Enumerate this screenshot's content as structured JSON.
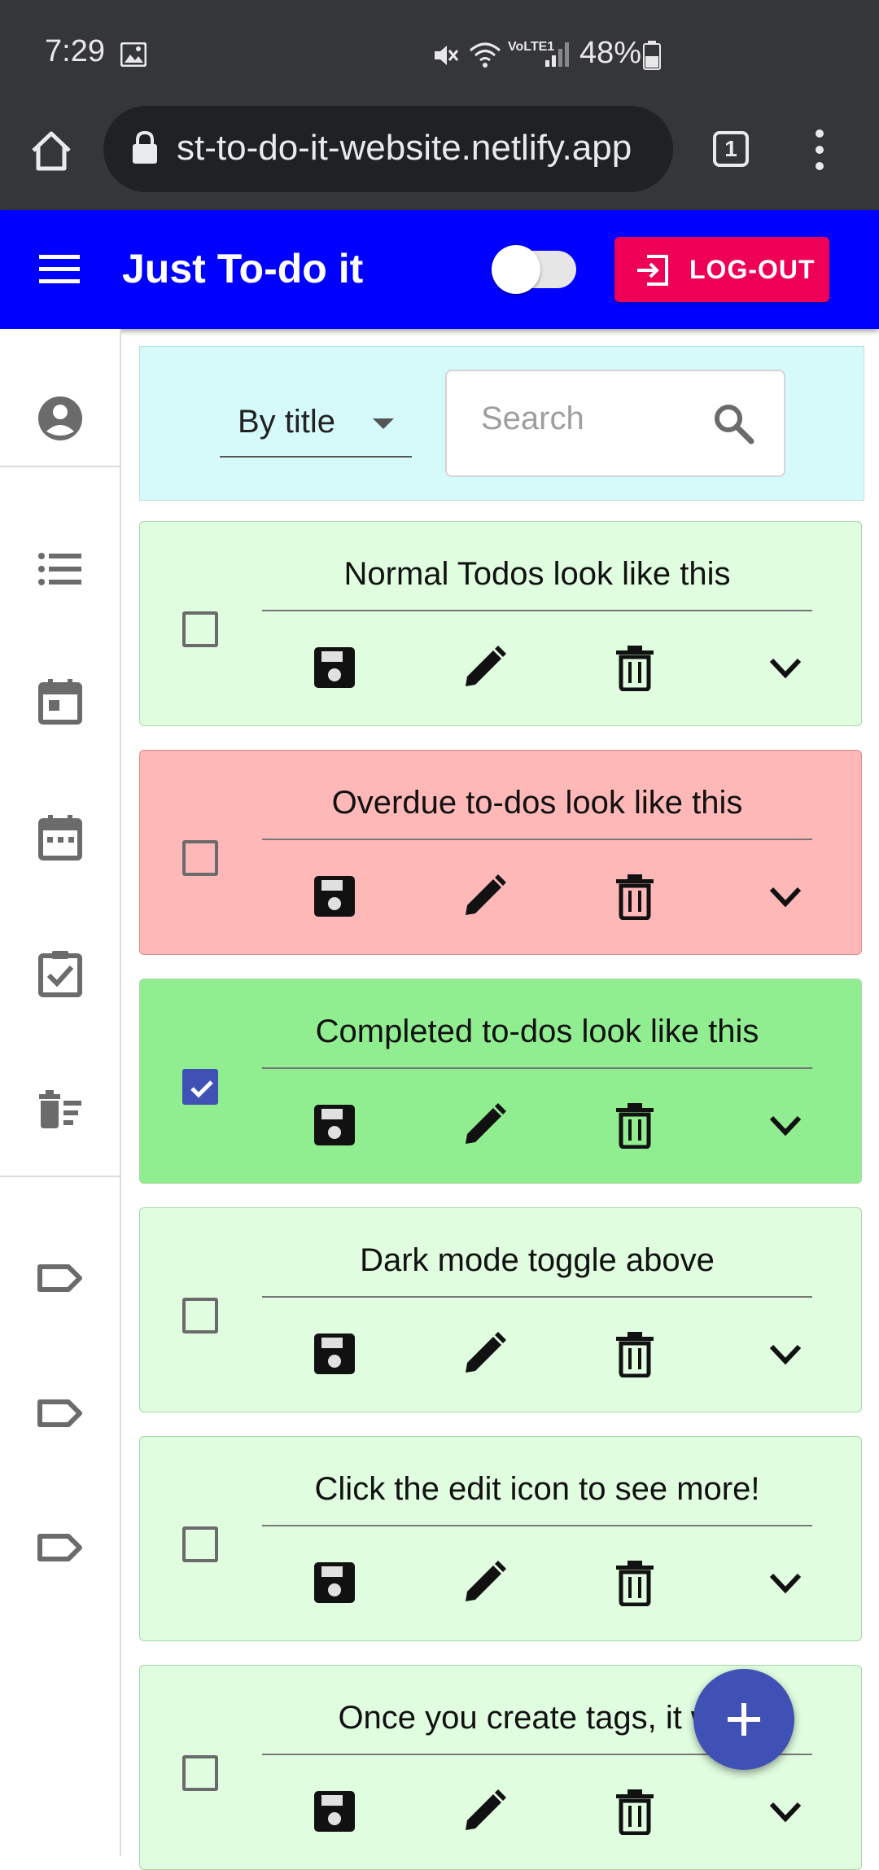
{
  "status_bar": {
    "time": "7:29",
    "battery": "48%",
    "network": "VoLTE1"
  },
  "browser": {
    "url": "st-to-do-it-website.netlify.app",
    "tab_count": "1"
  },
  "app_bar": {
    "title": "Just To-do it",
    "dark_mode_on": false,
    "logout_label": "LOG-OUT"
  },
  "sidebar": {
    "items": [
      {
        "icon": "account-circle-icon"
      },
      {
        "icon": "list-icon"
      },
      {
        "icon": "calendar-today-icon"
      },
      {
        "icon": "calendar-week-icon"
      },
      {
        "icon": "assignment-done-icon"
      },
      {
        "icon": "delete-sweep-icon"
      },
      {
        "icon": "label-icon"
      },
      {
        "icon": "label-icon"
      },
      {
        "icon": "label-icon"
      }
    ]
  },
  "filter": {
    "sort_selected": "By title",
    "search_placeholder": "Search",
    "search_value": ""
  },
  "todos": [
    {
      "title": "Normal Todos look like this",
      "checked": false,
      "status": "normal",
      "bg": "#e0fde0"
    },
    {
      "title": "Overdue to-dos look like this",
      "checked": false,
      "status": "overdue",
      "bg": "#ffb8b8"
    },
    {
      "title": "Completed to-dos look like this",
      "checked": true,
      "status": "completed",
      "bg": "#90ee90"
    },
    {
      "title": "Dark mode toggle above",
      "checked": false,
      "status": "normal",
      "bg": "#e0fde0"
    },
    {
      "title": "Click the edit icon to see more!",
      "checked": false,
      "status": "normal",
      "bg": "#e0fde0"
    },
    {
      "title": "Once you create tags, it will",
      "checked": false,
      "status": "normal",
      "bg": "#e0fde0"
    }
  ],
  "colors": {
    "app_bar": "#0000ff",
    "logout": "#ee0056",
    "fab": "#3f51b5",
    "filter_panel": "#d6fafa"
  }
}
